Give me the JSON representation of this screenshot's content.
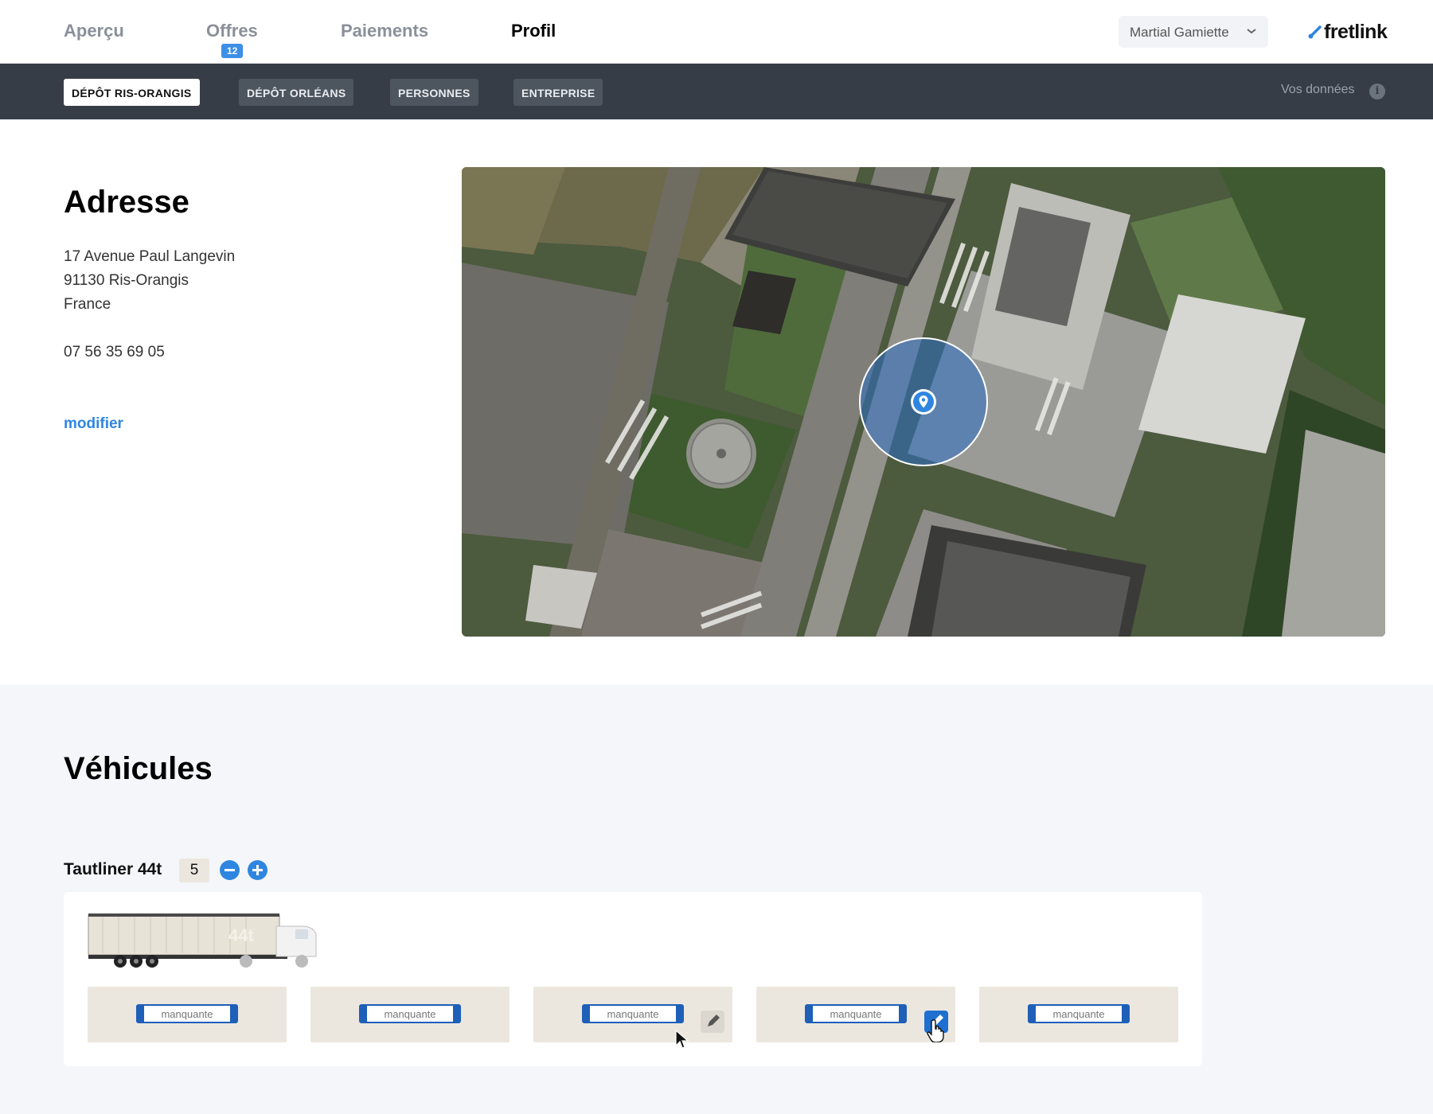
{
  "nav": {
    "items": [
      {
        "label": "Aperçu"
      },
      {
        "label": "Offres",
        "badge": "12"
      },
      {
        "label": "Paiements"
      },
      {
        "label": "Profil"
      }
    ],
    "active": "Profil",
    "user": "Martial Gamiette",
    "brand": "fretlink"
  },
  "subnav": {
    "tabs": [
      {
        "label": "DÉPÔT RIS-ORANGIS"
      },
      {
        "label": "DÉPÔT ORLÉANS"
      },
      {
        "label": "PERSONNES"
      },
      {
        "label": "ENTREPRISE"
      }
    ],
    "active": "DÉPÔT RIS-ORANGIS",
    "data_link": "Vos données",
    "info_glyph": "i"
  },
  "address": {
    "title": "Adresse",
    "line1": "17 Avenue Paul Langevin",
    "line2": "91130 Ris-Orangis",
    "line3": "France",
    "phone": "07 56 35 69 05",
    "edit_label": "modifier"
  },
  "vehicles": {
    "title": "Véhicules",
    "type_label": "Tautliner 44t",
    "count": "5",
    "truck_tag": "44t",
    "plates": [
      {
        "label": "manquante"
      },
      {
        "label": "manquante"
      },
      {
        "label": "manquante"
      },
      {
        "label": "manquante"
      },
      {
        "label": "manquante"
      }
    ]
  },
  "colors": {
    "accent": "#2f86e0",
    "subnav_bg": "#363d46",
    "plate_blue": "#1e5fb8",
    "slot_bg": "#ebe7df"
  }
}
